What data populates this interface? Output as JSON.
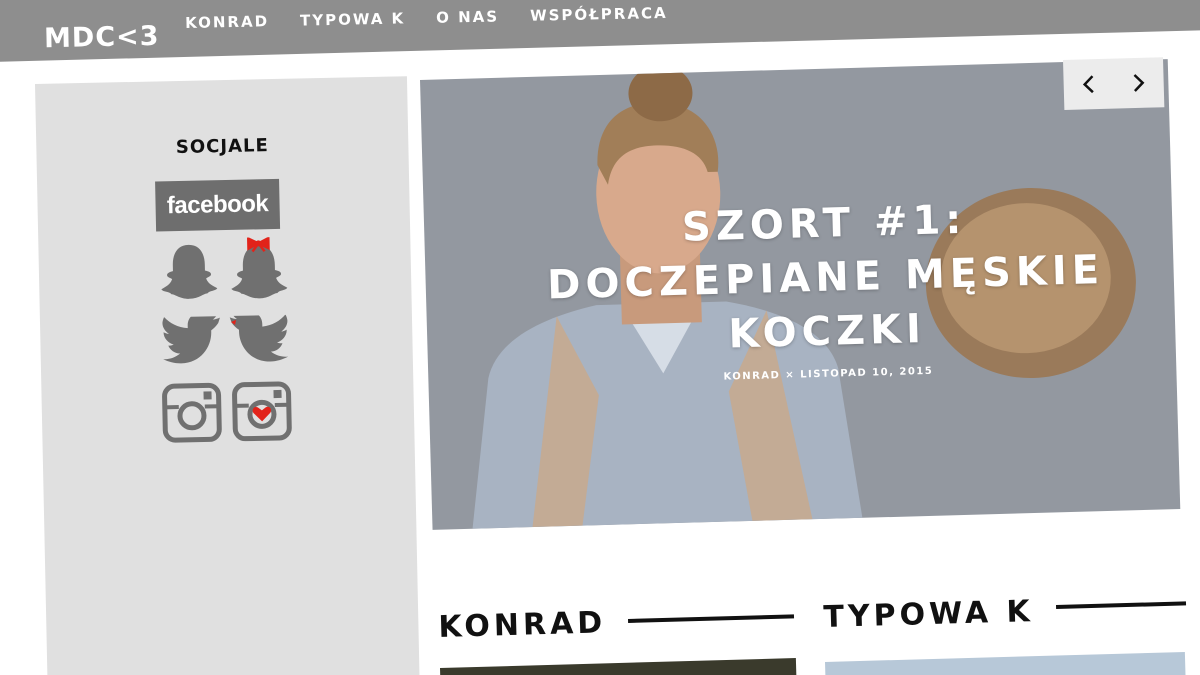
{
  "nav": {
    "logo": "MDC<3",
    "items": [
      {
        "label": "KONRAD"
      },
      {
        "label": "TYPOWA K"
      },
      {
        "label": "O NAS"
      },
      {
        "label": "WSPÓŁPRACA"
      }
    ]
  },
  "sidebar": {
    "title": "SOCJALE",
    "facebook_label": "facebook",
    "icons": [
      "facebook-icon",
      "snapchat-icon",
      "snapchat-bow-icon",
      "twitter-icon",
      "twitter-kiss-icon",
      "instagram-icon",
      "instagram-heart-icon"
    ]
  },
  "hero": {
    "title": "SZORT #1:\nDOCZEPIANE MĘSKIE\nKOCZKI",
    "meta": "KONRAD × LISTOPAD 10, 2015",
    "colors": {
      "background": "#9398a0",
      "accent": "#e2231a"
    }
  },
  "sections": [
    {
      "title": "KONRAD"
    },
    {
      "title": "TYPOWA K"
    }
  ]
}
